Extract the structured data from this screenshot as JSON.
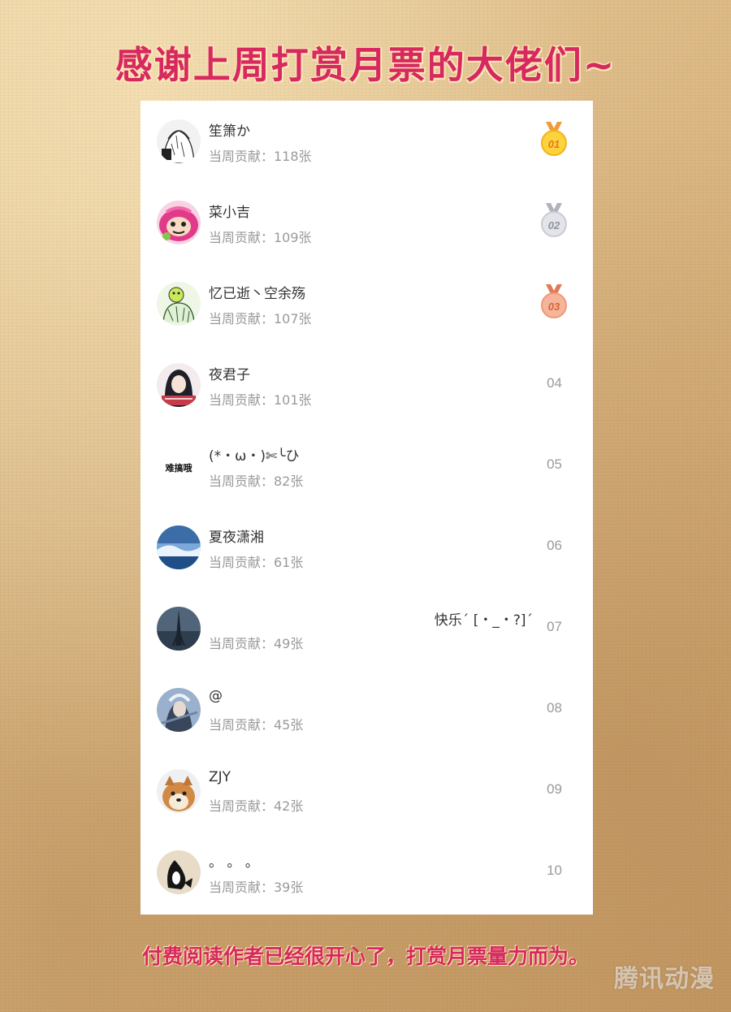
{
  "header": {
    "title": "感谢上周打赏月票的大佬们~"
  },
  "list": {
    "contribution_prefix": "当周贡献：",
    "items": [
      {
        "name": "笙箫か",
        "contribution": "当周贡献：118张",
        "rank": "01",
        "medal": "gold"
      },
      {
        "name": "菜小吉",
        "contribution": "当周贡献：109张",
        "rank": "02",
        "medal": "silver"
      },
      {
        "name": "忆已逝丶空余殇",
        "contribution": "当周贡献：107张",
        "rank": "03",
        "medal": "bronze"
      },
      {
        "name": "夜君子",
        "contribution": "当周贡献：101张",
        "rank": "04"
      },
      {
        "name": "(*・ω・)✄╰ひ",
        "contribution": "当周贡献：82张",
        "rank": "05",
        "avatar_text": "难搞哦"
      },
      {
        "name": "夏夜潇湘",
        "contribution": "当周贡献：61张",
        "rank": "06"
      },
      {
        "name": "快乐ˊ [・_・?]ˊ",
        "contribution": "当周贡献：49张",
        "rank": "07"
      },
      {
        "name": "@",
        "contribution": "当周贡献：45张",
        "rank": "08"
      },
      {
        "name": "ZJY",
        "contribution": "当周贡献：42张",
        "rank": "09"
      },
      {
        "name": "。 。 。",
        "contribution": "当周贡献：39张",
        "rank": "10"
      }
    ]
  },
  "footer": {
    "text": "付费阅读作者已经很开心了，打赏月票量力而为。"
  },
  "watermark": {
    "text": "腾讯动漫"
  },
  "colors": {
    "title": "#d7285f",
    "gold": "#f5b21f",
    "silver": "#c9ccd3",
    "bronze": "#ee9a76",
    "muted_text": "#9a9a9a"
  }
}
